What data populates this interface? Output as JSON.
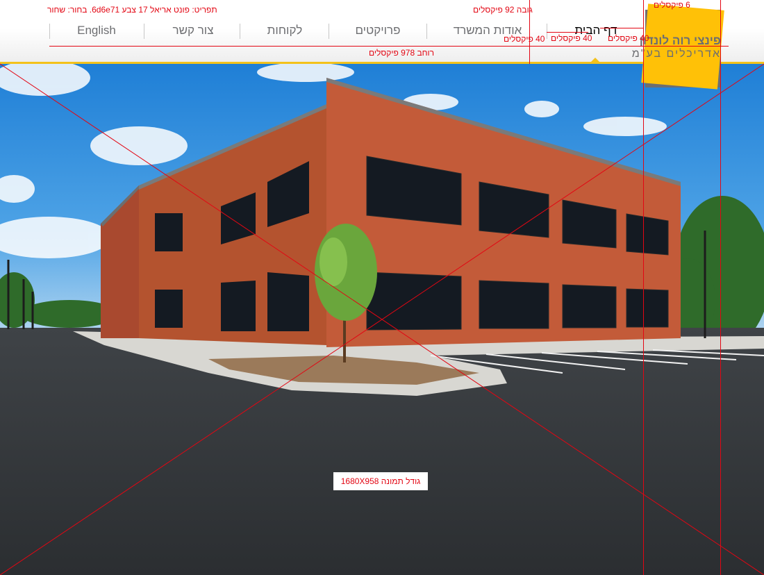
{
  "header": {
    "nav": [
      {
        "label": "דף הבית",
        "active": true
      },
      {
        "label": "אודות המשרד",
        "active": false
      },
      {
        "label": "פרויקטים",
        "active": false
      },
      {
        "label": "לקוחות",
        "active": false
      },
      {
        "label": "צור קשר",
        "active": false
      },
      {
        "label": "English",
        "active": false
      }
    ],
    "logo": {
      "name": "פינצי רוה לונדון",
      "subtitle": "אדריכלים בע\"מ"
    }
  },
  "annotations": {
    "font_spec": "תפריט: פונט אריאל 17 צבע 6d6e71. בחור: שחור",
    "header_height": "גובה 92 פיקסלים",
    "top_gap": "6 פיקסלים",
    "spacing_1": "40 פיקסלים",
    "spacing_2": "40 פיקסלים",
    "spacing_3": "40 פיקסלים",
    "content_width": "רוחב 978 פיקסלים",
    "image_size": "גודל תמונה 1680X958"
  },
  "colors": {
    "accent": "#ffc107",
    "header_line": "#f3c21b",
    "menu_text": "#6d6e71",
    "menu_active": "#000000",
    "annotation": "#e30613"
  }
}
